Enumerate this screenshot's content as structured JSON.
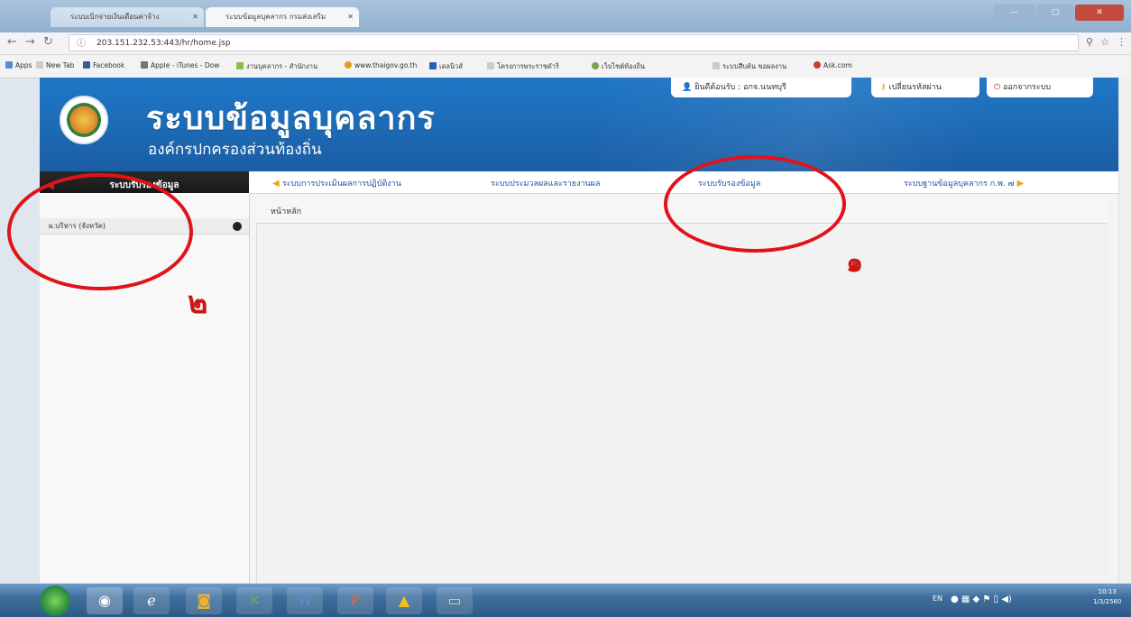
{
  "browser": {
    "tabs": [
      {
        "label": "ระบบเบิกจ่ายเงินเดือนค่าจ้าง"
      },
      {
        "label": "ระบบข้อมูลบุคลากร กรมส่งเสริม"
      }
    ],
    "url": "203.151.232.53:443/hr/home.jsp",
    "bookmarks": [
      "Apps",
      "New Tab",
      "Facebook",
      "Apple - iTunes - Dow",
      "งานบุคลากร - สำนักงาน",
      "www.thaigov.go.th",
      "เดลนิวส์",
      "โครงการพระราชดำริ",
      "เว็บไซต์ท้องถิ่น",
      "ระบบสืบค้น ขอผลงาน",
      "Ask.com"
    ]
  },
  "header": {
    "title": "ระบบข้อมูลบุคลากร",
    "subtitle": "องค์กรปกครองส่วนท้องถิ่น",
    "user_label": "ยินดีต้อนรับ : อกจ.นนทบุรี",
    "change_password": "เปลี่ยนรหัสผ่าน",
    "logout": "ออกจากระบบ"
  },
  "menu": {
    "sidebar_title": "ระบบรับรองข้อมูล",
    "items": [
      "ระบบการประเมินผลการปฏิบัติงาน",
      "ระบบประมวลผลและรายงานผล",
      "ระบบรับรองข้อมูล",
      "ระบบฐานข้อมูลบุคลากร ก.พ. ๗"
    ]
  },
  "sidebar": {
    "items": [
      "ผ.บริหาร (จังหวัด)"
    ]
  },
  "content": {
    "breadcrumb": "หน้าหลัก"
  },
  "annotations": {
    "num1": "๑",
    "num2": "๒"
  },
  "taskbar": {
    "lang": "EN",
    "time": "10:13",
    "date": "1/3/2560"
  },
  "colors": {
    "header_blue": "#1d6ab5",
    "annotation_red": "#e0131a",
    "link_blue": "#1f4fa3"
  }
}
